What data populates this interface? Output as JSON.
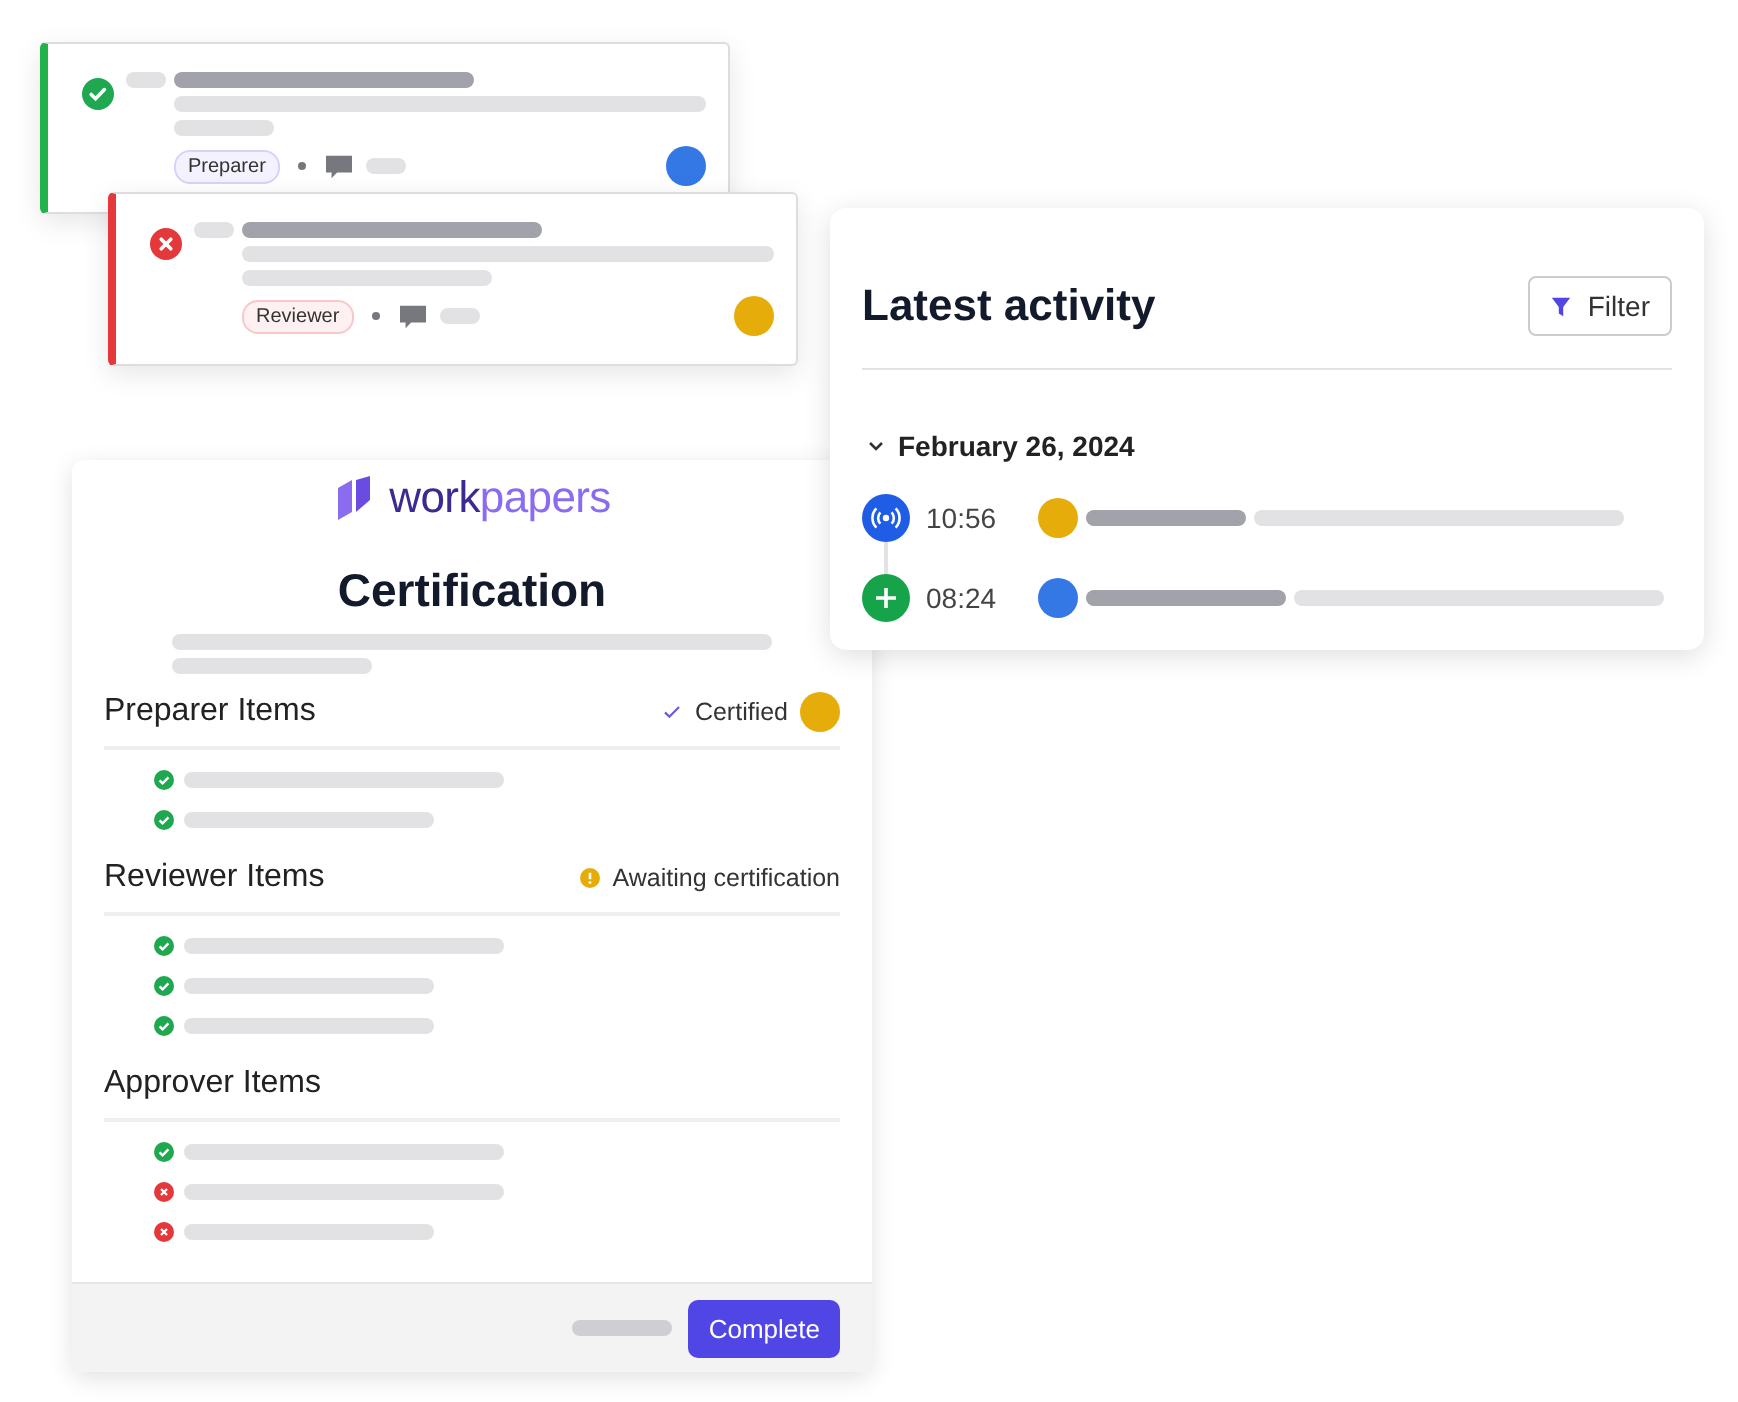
{
  "review_cards": [
    {
      "passed": true,
      "role": "Preparer",
      "kind": "preparer",
      "color": "#3478e6"
    },
    {
      "passed": false,
      "role": "Reviewer",
      "kind": "reviewer",
      "color": "#e6ad0a"
    }
  ],
  "activity": {
    "title": "Latest activity",
    "filter_button": "Filter",
    "groups": [
      {
        "date": "February 26, 2024",
        "expanded": true,
        "events": [
          {
            "kind": "broadcast",
            "time": "10:56",
            "color": "#e6ad0a"
          },
          {
            "kind": "add",
            "time": "08:24",
            "color": "#3478e6"
          }
        ]
      }
    ]
  },
  "certification": {
    "logo": [
      "work",
      "papers"
    ],
    "title": "Certification",
    "sections": [
      {
        "title": "Preparer Items",
        "status": {
          "kind": "certified",
          "text": "Certified",
          "color": "#e6ad0a"
        },
        "items": [
          {
            "passed": true
          },
          {
            "passed": true
          }
        ]
      },
      {
        "title": "Reviewer Items",
        "status": {
          "kind": "awaiting",
          "text": "Awaiting certification"
        },
        "items": [
          {
            "passed": true
          },
          {
            "passed": true
          },
          {
            "passed": true
          }
        ]
      },
      {
        "title": "Approver Items",
        "items": [
          {
            "passed": true
          },
          {
            "passed": false
          },
          {
            "passed": false
          }
        ]
      }
    ],
    "complete_button": "Complete"
  }
}
